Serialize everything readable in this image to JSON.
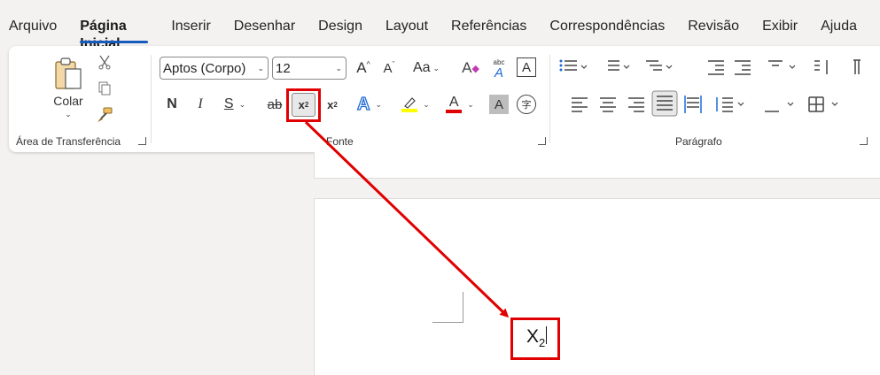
{
  "menu": [
    "Arquivo",
    "Página Inicial",
    "Inserir",
    "Desenhar",
    "Design",
    "Layout",
    "Referências",
    "Correspondências",
    "Revisão",
    "Exibir",
    "Ajuda"
  ],
  "clipboard": {
    "paste_label": "Colar",
    "group_label": "Área de Transferência"
  },
  "font": {
    "family_value": "Aptos (Corpo)",
    "size_value": "12",
    "group_label": "Fonte",
    "case_label": "Aa",
    "bold_label": "N",
    "italic_label": "I",
    "underline_label": "S",
    "strike_label": "ab",
    "subscript_label": "x",
    "subscript_index": "2",
    "superscript_label": "x",
    "superscript_index": "2",
    "text_effect_label": "A",
    "font_color_label": "A",
    "char_shading_label": "A",
    "enclose_label": "字",
    "clear_format_label": "A",
    "phonetic_top": "abc",
    "phonetic_bottom": "A",
    "border_label": "A"
  },
  "paragraph": {
    "group_label": "Parágrafo"
  },
  "document": {
    "text_base": "X",
    "text_sub": "2"
  },
  "colors": {
    "accent": "#185abd",
    "highlight": "#ffff00",
    "font_color": "#ff0000",
    "annotation": "#e00000"
  }
}
